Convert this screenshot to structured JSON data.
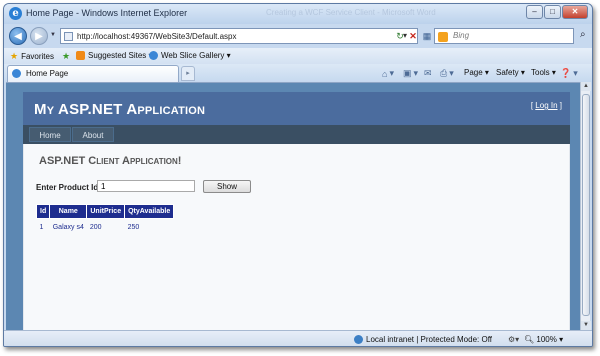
{
  "window": {
    "title": "Home Page - Windows Internet Explorer",
    "background_title": "Creating a WCF Service Client - Microsoft Word"
  },
  "address_bar": {
    "url": "http://localhost:49367/WebSite3/Default.aspx"
  },
  "search": {
    "placeholder": "Bing"
  },
  "favorites_bar": {
    "favorites_label": "Favorites",
    "suggested_sites": "Suggested Sites ▾",
    "web_slice_gallery": "Web Slice Gallery ▾"
  },
  "tab": {
    "label": "Home Page"
  },
  "command_bar": {
    "page": "Page ▾",
    "safety": "Safety ▾",
    "tools": "Tools ▾"
  },
  "site": {
    "title": "My ASP.NET Application",
    "login_open": "[ ",
    "login_link": "Log In",
    "login_close": " ]",
    "menu": [
      "Home",
      "About"
    ]
  },
  "main": {
    "heading": "ASP.NET Client Application!",
    "product_id_label": "Enter Product Id",
    "product_id_value": "1",
    "show_button": "Show",
    "table": {
      "columns": [
        "Id",
        "Name",
        "UnitPrice",
        "QtyAvailable"
      ],
      "rows": [
        [
          "1",
          "Galaxy s4",
          "200",
          "250"
        ]
      ]
    }
  },
  "status_bar": {
    "zone": "Local intranet | Protected Mode: Off",
    "zoom": "100%"
  },
  "colors": {
    "site_header": "#4b6c9e",
    "menu_bar": "#3a4f63",
    "grid_header": "#1e2d8f"
  }
}
